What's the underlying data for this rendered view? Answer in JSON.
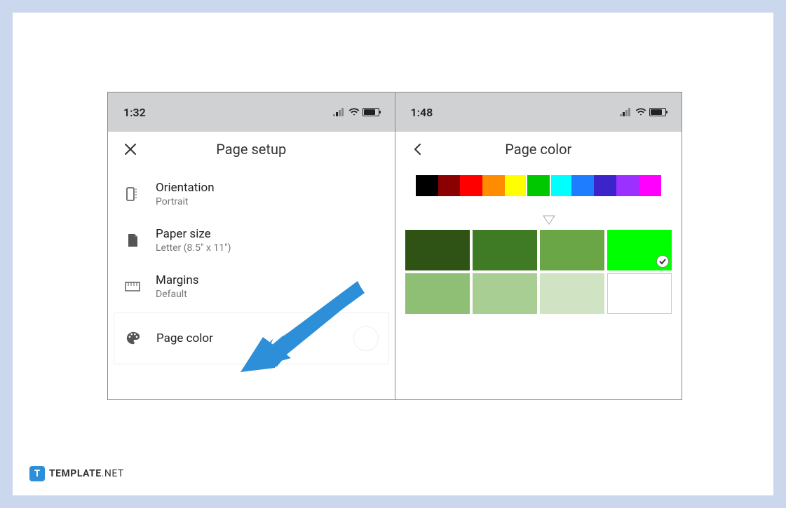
{
  "left": {
    "time": "1:32",
    "title": "Page setup",
    "items": [
      {
        "title": "Orientation",
        "sub": "Portrait"
      },
      {
        "title": "Paper size",
        "sub": "Letter (8.5\" x 11\")"
      },
      {
        "title": "Margins",
        "sub": "Default"
      }
    ],
    "pagecolor_label": "Page color",
    "pagecolor_value": "#ffffff"
  },
  "right": {
    "time": "1:48",
    "title": "Page color",
    "strip_colors": [
      "#000000",
      "#8b0000",
      "#ff0000",
      "#ff8c00",
      "#ffff00",
      "#00c800",
      "#00ffff",
      "#1e7dff",
      "#3b24c9",
      "#9b30ff",
      "#ff00ff"
    ],
    "selected_strip_index": 5,
    "shades": [
      "#2f5215",
      "#3f7a24",
      "#6ba646",
      "#00ff00",
      "#8fbf74",
      "#a9ce93",
      "#d0e3c3",
      "#ffffff"
    ],
    "selected_shade_index": 3
  },
  "footer": {
    "badge": "T",
    "brand": "TEMPLATE",
    "tld": ".NET"
  },
  "arrow_color": "#2c8fd8"
}
